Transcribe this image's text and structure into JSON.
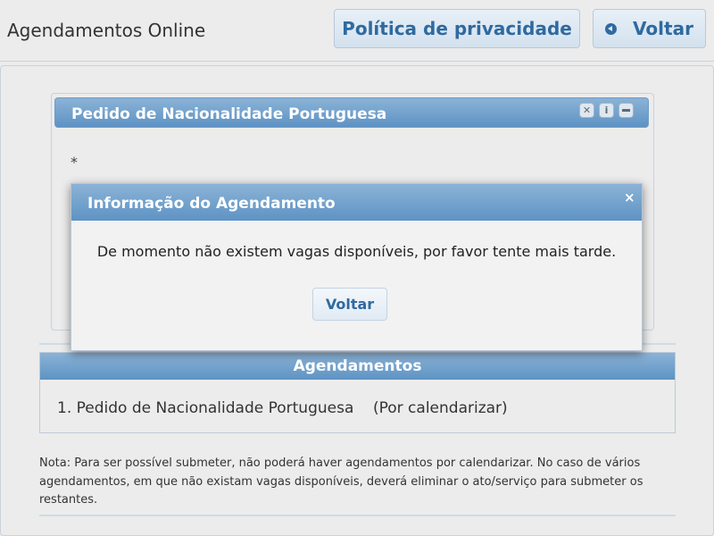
{
  "header": {
    "title": "Agendamentos Online",
    "privacy_label": "Política de privacidade",
    "back_label": "Voltar"
  },
  "portlet": {
    "title": "Pedido de Nacionalidade Portuguesa",
    "icons": [
      "close-icon",
      "info-icon",
      "minimize-icon"
    ],
    "info_glyph": "i",
    "asterisk": "*"
  },
  "agendamentos": {
    "header": "Agendamentos",
    "items": [
      {
        "text": "1. Pedido de Nacionalidade Portuguesa    (Por calendarizar)"
      }
    ]
  },
  "note": "Nota: Para ser possível submeter, não poderá haver agendamentos por calendarizar. No caso de vários agendamentos, em que não existam vagas disponíveis, deverá eliminar o ato/serviço para submeter os restantes.",
  "modal": {
    "title": "Informação do Agendamento",
    "close_glyph": "×",
    "message": "De momento não existem vagas disponíveis, por favor tente mais tarde.",
    "button_label": "Voltar"
  },
  "colors": {
    "accent": "#2f6aa0",
    "header_gradient_top": "#8bb3d6",
    "header_gradient_bottom": "#5e93c4",
    "background": "#ececec"
  }
}
